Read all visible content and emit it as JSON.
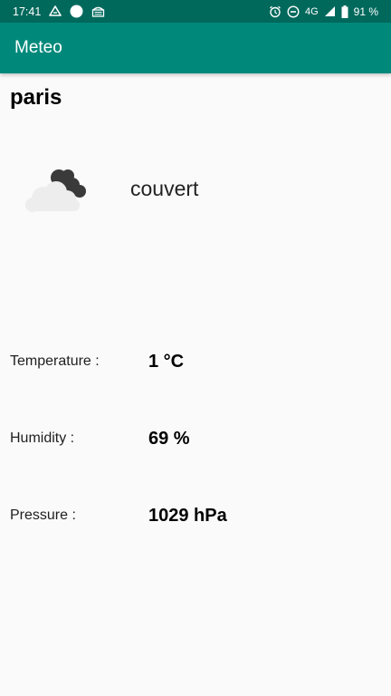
{
  "status_bar": {
    "time": "17:41",
    "network": "4G",
    "battery": "91 %",
    "icons": [
      "drive-icon",
      "circle-icon",
      "news-icon",
      "alarm-icon",
      "dnd-icon",
      "signal-icon",
      "battery-icon"
    ]
  },
  "app_bar": {
    "title": "Meteo",
    "color": "#00897b",
    "status_color": "#00695c"
  },
  "weather": {
    "city": "paris",
    "icon": "overcast-cloud-icon",
    "description": "couvert",
    "temperature_label": "Temperature :",
    "temperature_value": "1 °C",
    "humidity_label": "Humidity :",
    "humidity_value": "69 %",
    "pressure_label": "Pressure :",
    "pressure_value": "1029 hPa"
  }
}
